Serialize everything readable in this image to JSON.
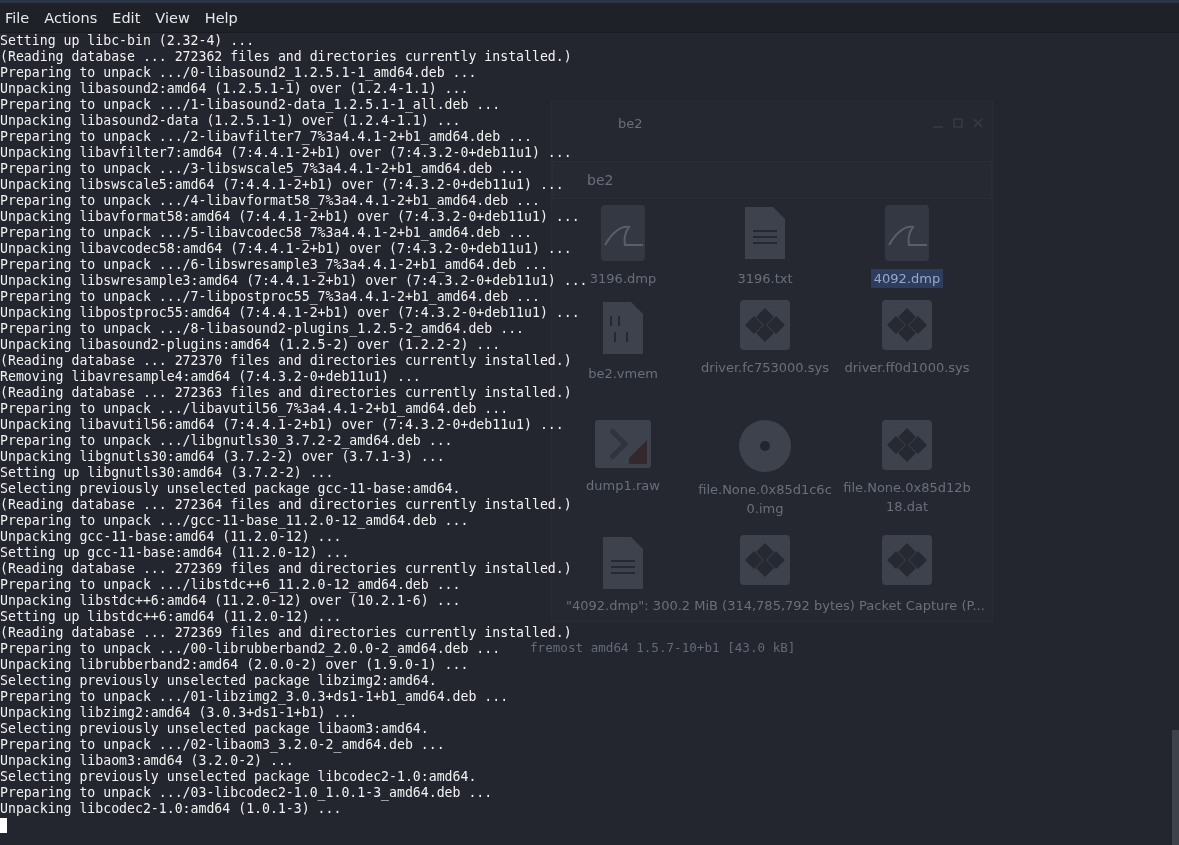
{
  "menu": [
    {
      "label": "File"
    },
    {
      "label": "Actions"
    },
    {
      "label": "Edit"
    },
    {
      "label": "View"
    },
    {
      "label": "Help"
    }
  ],
  "background_window": {
    "title": "be2",
    "path": "be2",
    "files": [
      {
        "name": "3196.dmp",
        "kind": "capture",
        "selected": false
      },
      {
        "name": "3196.txt",
        "kind": "text",
        "selected": false
      },
      {
        "name": "4092.dmp",
        "kind": "capture",
        "selected": true
      },
      {
        "name": "be2.vmem",
        "kind": "binary",
        "selected": false
      },
      {
        "name": "driver.fc753000.sys",
        "kind": "executable",
        "selected": false
      },
      {
        "name": "driver.ff0d1000.sys",
        "kind": "executable",
        "selected": false
      },
      {
        "name": "dump1.raw",
        "kind": "script",
        "selected": false
      },
      {
        "name": "file.None.0x85d1c6c0.img",
        "kind": "disc",
        "selected": false
      },
      {
        "name": "file.None.0x85d12b18.dat",
        "kind": "executable",
        "selected": false
      },
      {
        "kind": "text"
      },
      {
        "kind": "executable"
      },
      {
        "kind": "executable"
      }
    ],
    "status": "\"4092.dmp\": 300.2 MiB (314,785,792 bytes) Packet Capture (P..."
  },
  "background_terminal_line": "fremost amd64 1.5.7-10+b1 [43.0 kB]",
  "lines": [
    "Setting up libc-bin (2.32-4) ...",
    "(Reading database ... 272362 files and directories currently installed.)",
    "Preparing to unpack .../0-libasound2_1.2.5.1-1_amd64.deb ...",
    "Unpacking libasound2:amd64 (1.2.5.1-1) over (1.2.4-1.1) ...",
    "Preparing to unpack .../1-libasound2-data_1.2.5.1-1_all.deb ...",
    "Unpacking libasound2-data (1.2.5.1-1) over (1.2.4-1.1) ...",
    "Preparing to unpack .../2-libavfilter7_7%3a4.4.1-2+b1_amd64.deb ...",
    "Unpacking libavfilter7:amd64 (7:4.4.1-2+b1) over (7:4.3.2-0+deb11u1) ...",
    "Preparing to unpack .../3-libswscale5_7%3a4.4.1-2+b1_amd64.deb ...",
    "Unpacking libswscale5:amd64 (7:4.4.1-2+b1) over (7:4.3.2-0+deb11u1) ...",
    "Preparing to unpack .../4-libavformat58_7%3a4.4.1-2+b1_amd64.deb ...",
    "Unpacking libavformat58:amd64 (7:4.4.1-2+b1) over (7:4.3.2-0+deb11u1) ...",
    "Preparing to unpack .../5-libavcodec58_7%3a4.4.1-2+b1_amd64.deb ...",
    "Unpacking libavcodec58:amd64 (7:4.4.1-2+b1) over (7:4.3.2-0+deb11u1) ...",
    "Preparing to unpack .../6-libswresample3_7%3a4.4.1-2+b1_amd64.deb ...",
    "Unpacking libswresample3:amd64 (7:4.4.1-2+b1) over (7:4.3.2-0+deb11u1) ...",
    "Preparing to unpack .../7-libpostproc55_7%3a4.4.1-2+b1_amd64.deb ...",
    "Unpacking libpostproc55:amd64 (7:4.4.1-2+b1) over (7:4.3.2-0+deb11u1) ...",
    "Preparing to unpack .../8-libasound2-plugins_1.2.5-2_amd64.deb ...",
    "Unpacking libasound2-plugins:amd64 (1.2.5-2) over (1.2.2-2) ...",
    "(Reading database ... 272370 files and directories currently installed.)",
    "Removing libavresample4:amd64 (7:4.3.2-0+deb11u1) ...",
    "(Reading database ... 272363 files and directories currently installed.)",
    "Preparing to unpack .../libavutil56_7%3a4.4.1-2+b1_amd64.deb ...",
    "Unpacking libavutil56:amd64 (7:4.4.1-2+b1) over (7:4.3.2-0+deb11u1) ...",
    "Preparing to unpack .../libgnutls30_3.7.2-2_amd64.deb ...",
    "Unpacking libgnutls30:amd64 (3.7.2-2) over (3.7.1-3) ...",
    "Setting up libgnutls30:amd64 (3.7.2-2) ...",
    "Selecting previously unselected package gcc-11-base:amd64.",
    "(Reading database ... 272364 files and directories currently installed.)",
    "Preparing to unpack .../gcc-11-base_11.2.0-12_amd64.deb ...",
    "Unpacking gcc-11-base:amd64 (11.2.0-12) ...",
    "Setting up gcc-11-base:amd64 (11.2.0-12) ...",
    "(Reading database ... 272369 files and directories currently installed.)",
    "Preparing to unpack .../libstdc++6_11.2.0-12_amd64.deb ...",
    "Unpacking libstdc++6:amd64 (11.2.0-12) over (10.2.1-6) ...",
    "Setting up libstdc++6:amd64 (11.2.0-12) ...",
    "(Reading database ... 272369 files and directories currently installed.)",
    "Preparing to unpack .../00-librubberband2_2.0.0-2_amd64.deb ...",
    "Unpacking librubberband2:amd64 (2.0.0-2) over (1.9.0-1) ...",
    "Selecting previously unselected package libzimg2:amd64.",
    "Preparing to unpack .../01-libzimg2_3.0.3+ds1-1+b1_amd64.deb ...",
    "Unpacking libzimg2:amd64 (3.0.3+ds1-1+b1) ...",
    "Selecting previously unselected package libaom3:amd64.",
    "Preparing to unpack .../02-libaom3_3.2.0-2_amd64.deb ...",
    "Unpacking libaom3:amd64 (3.2.0-2) ...",
    "Selecting previously unselected package libcodec2-1.0:amd64.",
    "Preparing to unpack .../03-libcodec2-1.0_1.0.1-3_amd64.deb ...",
    "Unpacking libcodec2-1.0:amd64 (1.0.1-3) ..."
  ]
}
